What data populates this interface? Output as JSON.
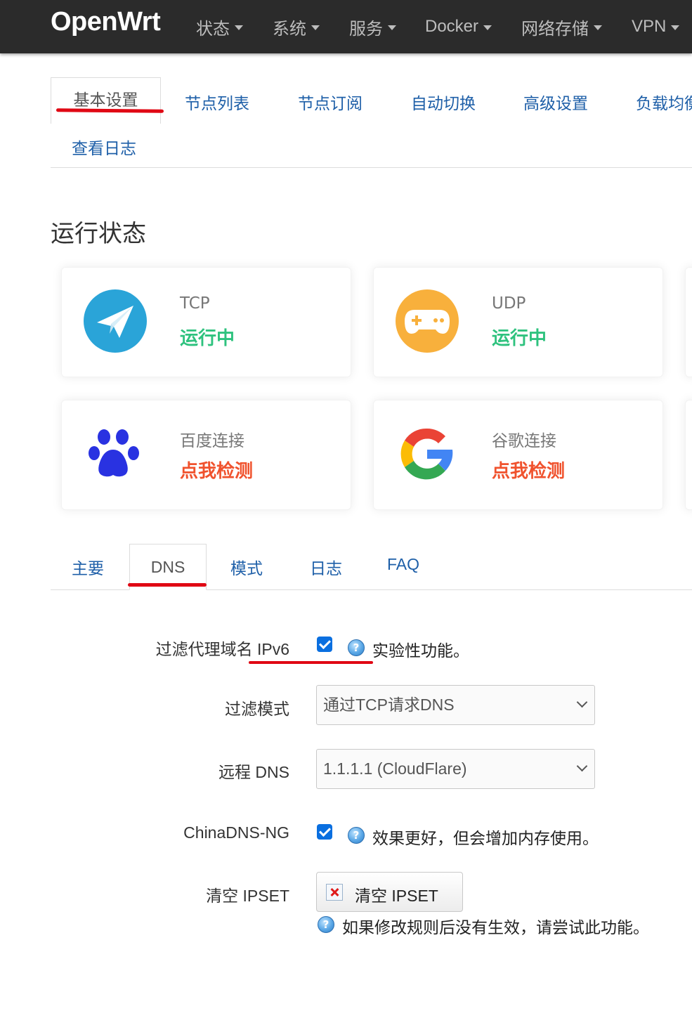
{
  "brand": "OpenWrt",
  "nav": [
    {
      "label": "状态"
    },
    {
      "label": "系统"
    },
    {
      "label": "服务"
    },
    {
      "label": "Docker"
    },
    {
      "label": "网络存储"
    },
    {
      "label": "VPN"
    }
  ],
  "top_tabs": {
    "active": "基本设置",
    "items": [
      "节点列表",
      "节点订阅",
      "自动切换",
      "高级设置",
      "负载均衡"
    ],
    "second_row": "查看日志"
  },
  "status_title": "运行状态",
  "cards": [
    {
      "label": "TCP",
      "value": "运行中",
      "icon": "paper-plane-icon"
    },
    {
      "label": "UDP",
      "value": "运行中",
      "icon": "gamepad-icon"
    },
    {
      "label": "百度连接",
      "value": "点我检测",
      "icon": "baidu-paw-icon"
    },
    {
      "label": "谷歌连接",
      "value": "点我检测",
      "icon": "google-g-icon"
    }
  ],
  "sub_tabs": [
    "主要",
    "DNS",
    "模式",
    "日志",
    "FAQ"
  ],
  "form": {
    "filter_ipv6": {
      "label": "过滤代理域名 IPv6",
      "checked": true,
      "help": "实验性功能。"
    },
    "filter_mode": {
      "label": "过滤模式",
      "value": "通过TCP请求DNS"
    },
    "remote_dns": {
      "label": "远程 DNS",
      "value": "1.1.1.1 (CloudFlare)"
    },
    "chinadns": {
      "label": "ChinaDNS-NG",
      "checked": true,
      "help": "效果更好，但会增加内存使用。"
    },
    "clear_ipset": {
      "label": "清空 IPSET",
      "button": "清空 IPSET",
      "help": "如果修改规则后没有生效，请尝试此功能。"
    }
  },
  "colors": {
    "accent": "#1e5fa8",
    "running": "#2ec27e",
    "check": "#f0522d",
    "annotation": "#e00814"
  }
}
